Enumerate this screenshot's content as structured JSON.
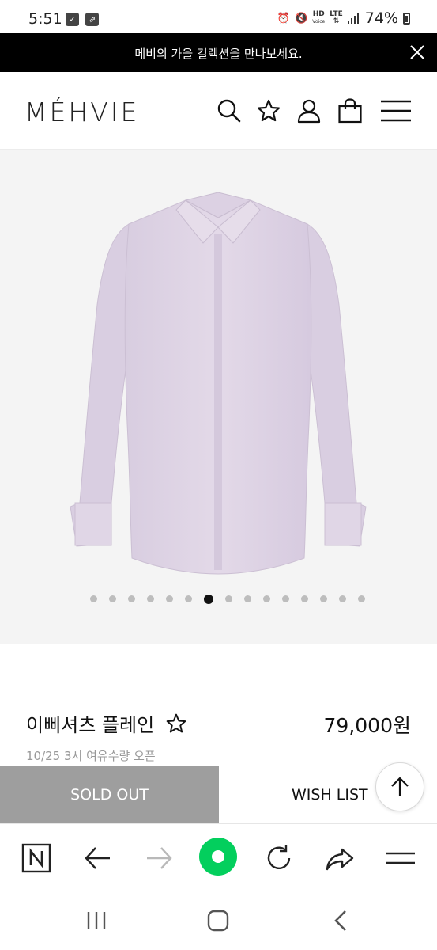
{
  "status_bar": {
    "time": "5:51",
    "battery": "74%",
    "hd_label": "HD",
    "voice_label": "Voice",
    "lte_label": "LTE"
  },
  "announcement": {
    "text": "메비의 가을 컬렉션을 만나보세요."
  },
  "header": {
    "logo": "MÉHVIE",
    "icons": [
      "search-icon",
      "star-icon",
      "user-icon",
      "shopping-bag-icon",
      "menu-icon"
    ]
  },
  "gallery": {
    "image_count": 15,
    "active_index": 6,
    "shirt_color": "#ddd2e3"
  },
  "product": {
    "name": "이삐셔츠 플레인",
    "price": "79,000원",
    "note": "10/25 3시 여유수량 오픈"
  },
  "actions": {
    "sold_out": "SOLD OUT",
    "wish_list": "WISH LIST"
  },
  "colors": {
    "sold_out_bg": "#9e9e9e",
    "announce_bg": "#000000",
    "naver_green": "#03cf5d"
  },
  "browser_toolbar": {
    "icons": [
      "naver-n-icon",
      "back-arrow-icon",
      "forward-arrow-icon",
      "green-dot-icon",
      "refresh-icon",
      "share-icon",
      "menu-icon"
    ]
  },
  "system_nav": {
    "icons": [
      "recent-apps-icon",
      "home-icon",
      "back-icon"
    ]
  }
}
